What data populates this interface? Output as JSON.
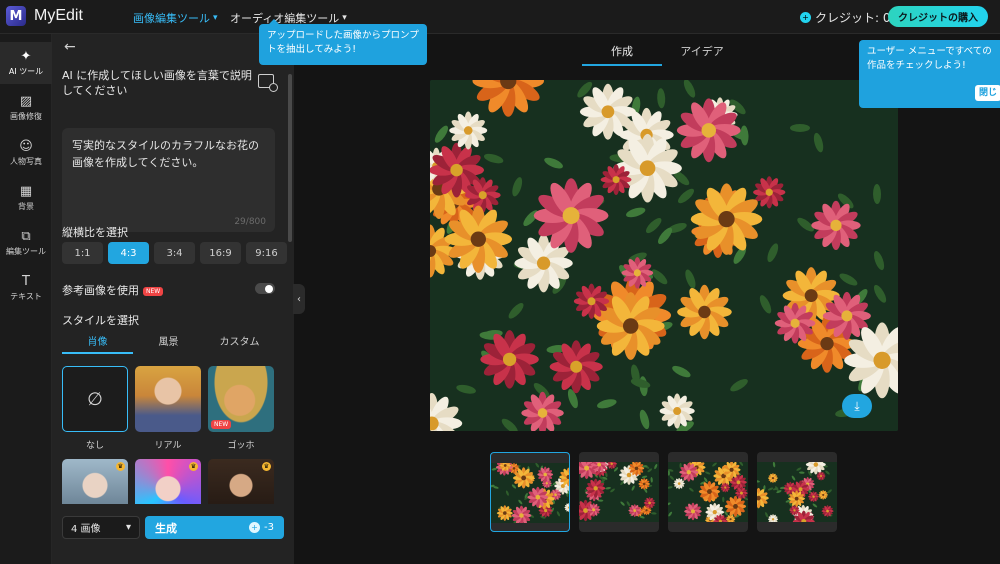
{
  "app": {
    "name": "MyEdit"
  },
  "topbar": {
    "nav": [
      {
        "label": "画像編集ツール",
        "active": true
      },
      {
        "label": "オーディオ編集ツール",
        "active": false
      }
    ],
    "credits_label": "クレジット: 0",
    "buy_label": "クレジットの購入"
  },
  "rail": [
    {
      "label": "AI ツール",
      "icon": "wand-icon",
      "glyph": "✦",
      "active": true
    },
    {
      "label": "画像修復",
      "icon": "image-repair-icon",
      "glyph": "▨",
      "active": false
    },
    {
      "label": "人物写真",
      "icon": "portrait-icon",
      "glyph": "☺",
      "active": false
    },
    {
      "label": "背景",
      "icon": "background-icon",
      "glyph": "▦",
      "active": false
    },
    {
      "label": "編集ツール",
      "icon": "edit-tools-icon",
      "glyph": "⧉",
      "active": false
    },
    {
      "label": "テキスト",
      "icon": "text-icon",
      "glyph": "T",
      "active": false
    }
  ],
  "panel": {
    "prompt_title": "AI に作成してほしい画像を言葉で説明してください",
    "prompt_text": "写実的なスタイルのカラフルなお花の画像を作成してください。",
    "char_count": "29/800",
    "aspect_label": "縦横比を選択",
    "aspect_ratios": [
      "1:1",
      "4:3",
      "3:4",
      "16:9",
      "9:16"
    ],
    "aspect_selected": "4:3",
    "reference_label": "参考画像を使用",
    "reference_badge": "NEW",
    "reference_enabled": false,
    "style_label": "スタイルを選択",
    "style_tabs": [
      "肖像",
      "風景",
      "カスタム"
    ],
    "style_tab_active": "肖像",
    "styles": [
      {
        "name": "なし",
        "selected": true,
        "badge": ""
      },
      {
        "name": "リアル",
        "selected": false,
        "badge": ""
      },
      {
        "name": "ゴッホ",
        "selected": false,
        "badge": "NEW"
      },
      {
        "name": "",
        "selected": false,
        "badge": ""
      },
      {
        "name": "",
        "selected": false,
        "badge": ""
      },
      {
        "name": "",
        "selected": false,
        "badge": ""
      }
    ],
    "image_count": "4 画像",
    "generate_label": "生成",
    "generate_cost": "-3"
  },
  "tooltip": {
    "text": "アップロードした画像からプロンプトを抽出してみよう!"
  },
  "main": {
    "tabs": [
      "作成",
      "アイデア"
    ],
    "active_tab": "作成",
    "result_count": 4,
    "selected_result": 1
  },
  "callout": {
    "text": "ユーザー メニューですべての作品をチェックしよう!",
    "close_label": "閉じ"
  },
  "colors": {
    "accent": "#22a6e0",
    "background": "#141414",
    "panel": "#232323"
  }
}
